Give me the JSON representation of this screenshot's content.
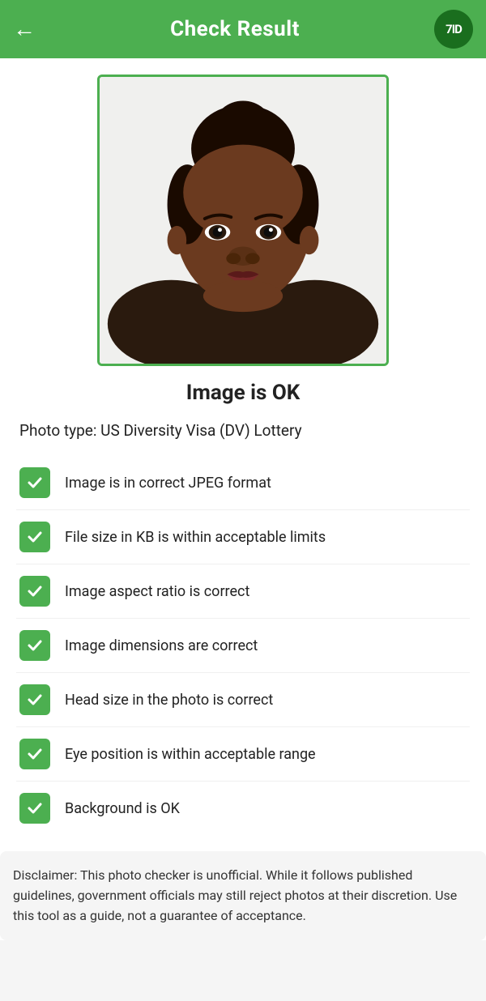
{
  "header": {
    "title": "Check Result",
    "back_icon": "←",
    "logo_text": "7ID"
  },
  "image_status": "Image is OK",
  "photo_type_label": "Photo type: US Diversity Visa (DV) Lottery",
  "checklist": [
    {
      "text": "Image is in correct JPEG format",
      "passed": true
    },
    {
      "text": "File size in KB is within acceptable limits",
      "passed": true
    },
    {
      "text": "Image aspect ratio is correct",
      "passed": true
    },
    {
      "text": "Image dimensions are correct",
      "passed": true
    },
    {
      "text": "Head size in the photo is correct",
      "passed": true
    },
    {
      "text": "Eye position is within acceptable range",
      "passed": true
    },
    {
      "text": "Background is OK",
      "passed": true
    }
  ],
  "disclaimer": "Disclaimer: This photo checker is unofficial. While it follows published guidelines, government officials may still reject photos at their discretion. Use this tool as a guide, not a guarantee of acceptance."
}
